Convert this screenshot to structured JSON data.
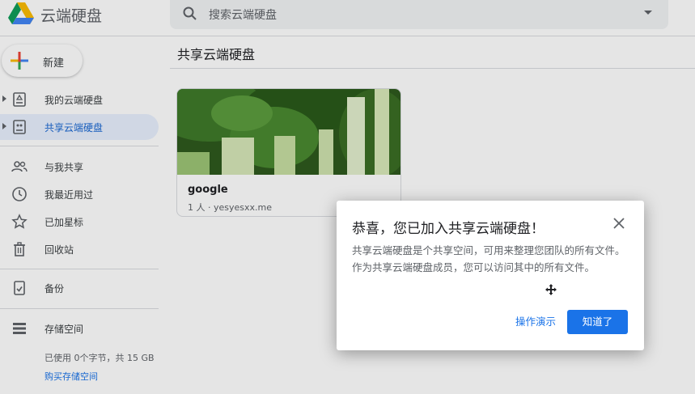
{
  "app": {
    "title": "云端硬盘"
  },
  "search": {
    "placeholder": "搜索云端硬盘"
  },
  "sidebar": {
    "new_label": "新建",
    "items": [
      {
        "label": "我的云端硬盘"
      },
      {
        "label": "共享云端硬盘"
      },
      {
        "label": "与我共享"
      },
      {
        "label": "我最近用过"
      },
      {
        "label": "已加星标"
      },
      {
        "label": "回收站"
      },
      {
        "label": "备份"
      },
      {
        "label": "存储空间"
      }
    ],
    "storage_text": "已使用 0个字节，共 15 GB",
    "buy_storage": "购买存储空间"
  },
  "main": {
    "title": "共享云端硬盘",
    "card": {
      "title": "google",
      "subtitle": "1 人 · yesyesxx.me"
    }
  },
  "dialog": {
    "title": "恭喜，您已加入共享云端硬盘！",
    "body": "共享云端硬盘是个共享空间，可用来整理您团队的所有文件。作为共享云端硬盘成员，您可以访问其中的所有文件。",
    "demo_button": "操作演示",
    "ok_button": "知道了"
  },
  "colors": {
    "accent": "#1a73e8",
    "active_nav_bg": "#e8f0fe"
  },
  "icons": [
    "drive-logo-icon",
    "search-icon",
    "chevron-down-icon",
    "plus-icon",
    "my-drive-icon",
    "shared-drive-icon",
    "people-icon",
    "clock-icon",
    "star-icon",
    "trash-icon",
    "backup-icon",
    "storage-icon",
    "close-icon",
    "move-cursor-icon"
  ]
}
